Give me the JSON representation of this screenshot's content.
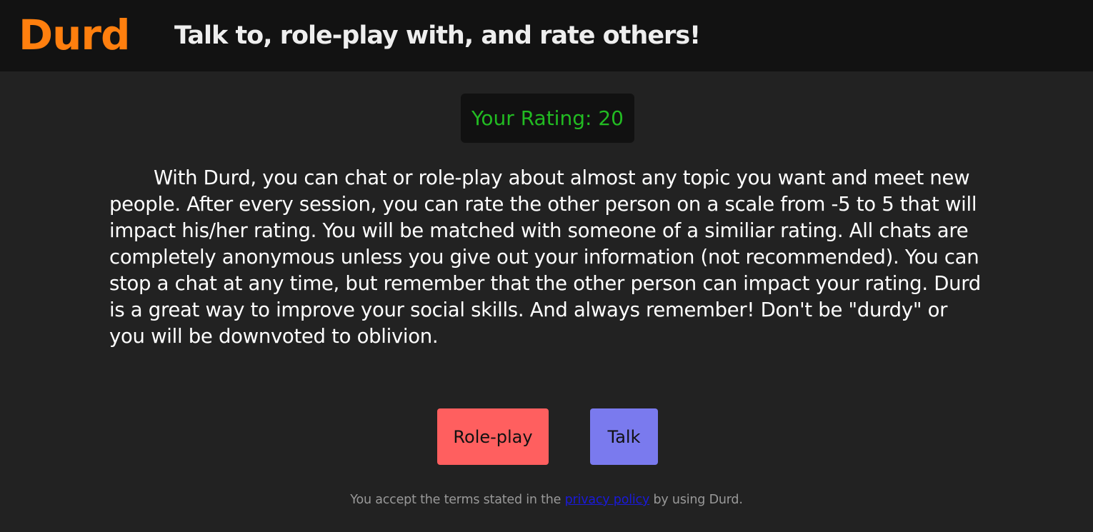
{
  "header": {
    "logo": "Durd",
    "tagline": "Talk to, role-play with, and rate others!"
  },
  "rating": {
    "text": "Your Rating: 20"
  },
  "description": "With Durd, you can chat or role-play about almost any topic you want and meet new people. After every session, you can rate the other person on a scale from -5 to 5 that will impact his/her rating. You will be matched with someone of a similiar rating. All chats are completely anonymous unless you give out your information (not recommended). You can stop a chat at any time, but remember that the other person can impact your rating. Durd is a great way to improve your social skills. And always remember! Don't be \"durdy\" or you will be downvoted to oblivion.",
  "buttons": {
    "roleplay_label": "Role-play",
    "talk_label": "Talk"
  },
  "footer": {
    "prefix": "You accept the terms stated in the ",
    "link_text": "privacy policy",
    "suffix": " by using Durd."
  },
  "colors": {
    "header_bg": "#121212",
    "page_bg": "#222222",
    "logo": "#ff7f0e",
    "rating_text": "#22bb22",
    "roleplay_button": "#ff5f5f",
    "talk_button": "#7a7aee",
    "link": "#1a1ad9"
  }
}
